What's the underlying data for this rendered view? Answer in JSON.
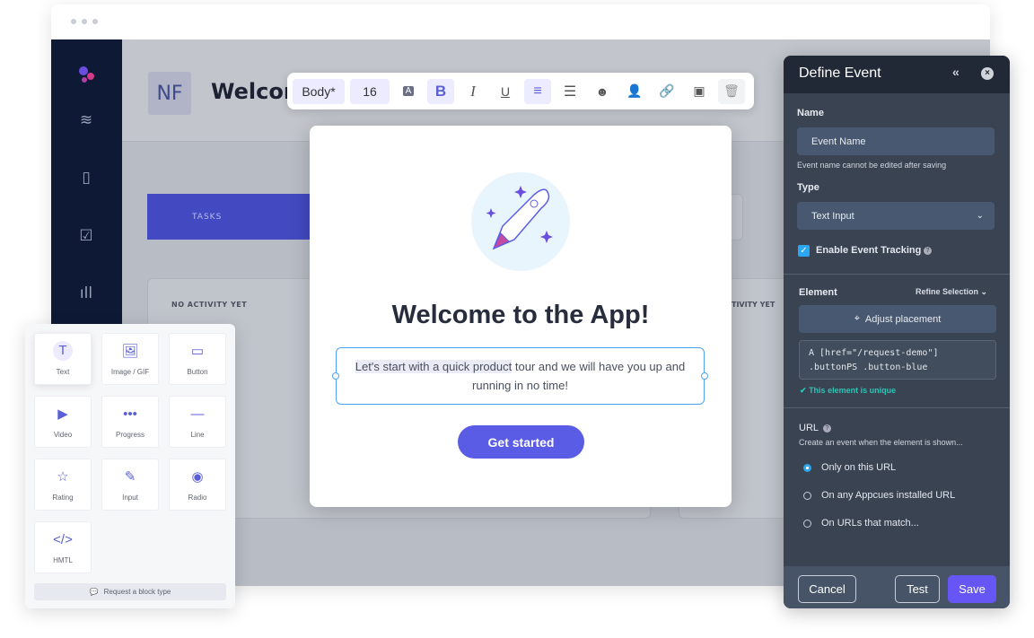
{
  "app": {
    "avatar_initials": "NF",
    "header_title": "Welcom",
    "tasks_label": "TASKS",
    "activity_label": "NO ACTIVITY YET",
    "activity_label_right": "TIVITY YET"
  },
  "toolbar": {
    "style": "Body*",
    "size": "16",
    "items": [
      "text-color-icon",
      "bold-icon",
      "italic-icon",
      "underline-icon",
      "align-center-icon",
      "list-icon",
      "emoji-icon",
      "user-personalize-icon",
      "link-icon",
      "frame-icon",
      "trash-icon"
    ]
  },
  "modal": {
    "title": "Welcome to the App!",
    "text_highlight": "Let's start with a quick product",
    "text_rest": " tour and we will have you up and running in no time!",
    "button": "Get started"
  },
  "panel": {
    "title": "Define Event",
    "name_label": "Name",
    "name_placeholder": "Event Name",
    "name_help": "Event name cannot be edited after saving",
    "type_label": "Type",
    "type_value": "Text Input",
    "tracking_label": "Enable Event Tracking",
    "tracking_checked": true,
    "element_label": "Element",
    "refine": "Refine Selection",
    "adjust": "Adjust placement",
    "selector_line1": "A [href=\"/request-demo\"]",
    "selector_line2": ".buttonPS .button-blue",
    "unique": "This element is unique",
    "url_label": "URL",
    "url_help": "Create an event when the element is shown...",
    "url_options": [
      "Only on this URL",
      "On any Appcues installed URL",
      "On URLs that match..."
    ],
    "url_selected": 0,
    "cancel": "Cancel",
    "test": "Test",
    "save": "Save"
  },
  "palette": {
    "blocks": [
      {
        "label": "Text",
        "icon": "T"
      },
      {
        "label": "Image / GIF",
        "icon": "🖼"
      },
      {
        "label": "Button",
        "icon": "▭"
      },
      {
        "label": "Video",
        "icon": "▶"
      },
      {
        "label": "Progress",
        "icon": "•••"
      },
      {
        "label": "Line",
        "icon": "—"
      },
      {
        "label": "Rating",
        "icon": "☆"
      },
      {
        "label": "Input",
        "icon": "✎"
      },
      {
        "label": "Radio",
        "icon": "◉"
      },
      {
        "label": "HMTL",
        "icon": "</>"
      }
    ],
    "request": "Request a block type"
  },
  "colors": {
    "accent": "#5b5ce6",
    "panel": "#394352",
    "sidebar": "#0e1936",
    "success": "#2ec4b6"
  }
}
